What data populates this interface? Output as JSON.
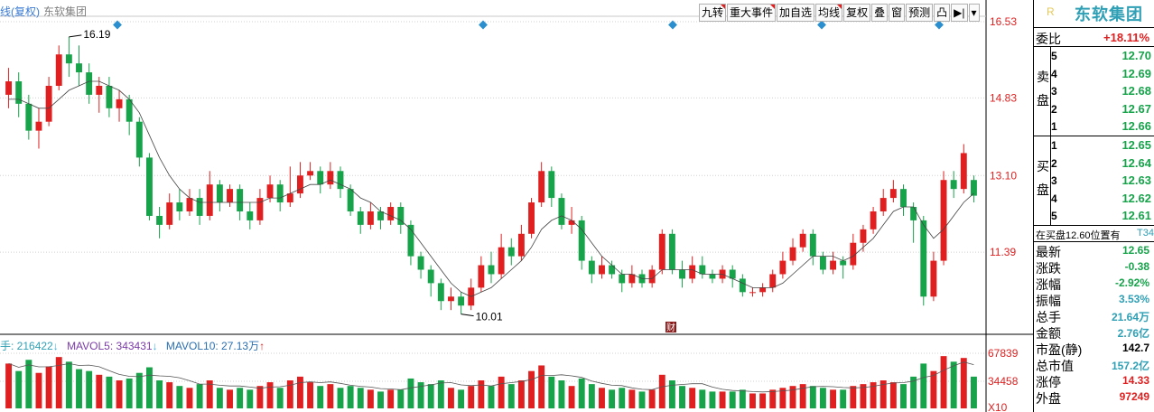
{
  "title": {
    "kline": "线(复权)",
    "stock": "东软集团"
  },
  "toolbar": [
    {
      "label": "九转",
      "flag": true
    },
    {
      "label": "重大事件",
      "flag": true
    },
    {
      "label": "加自选",
      "flag": false
    },
    {
      "label": "均线",
      "flag": true
    },
    {
      "label": "复权",
      "flag": false
    },
    {
      "label": "叠",
      "flag": false
    },
    {
      "label": "窗",
      "flag": false
    },
    {
      "label": "预测",
      "flag": false
    },
    {
      "label": "凸",
      "flag": false
    },
    {
      "label": "▶|",
      "flag": false
    },
    {
      "label": "▾",
      "flag": false
    }
  ],
  "colors": {
    "up": "#e02020",
    "down": "#16a34a",
    "ma": "#444444",
    "event": "#2b8fcf",
    "stock_name": "#2fa0b5"
  },
  "panel": {
    "stock_name": "东软集团",
    "r_mark": "R",
    "weibi_label": "委比",
    "weibi_value": "+18.11%",
    "sell_label": "卖盘",
    "buy_label": "买盘",
    "sell": [
      {
        "level": "5",
        "price": "12.70"
      },
      {
        "level": "4",
        "price": "12.69"
      },
      {
        "level": "3",
        "price": "12.68"
      },
      {
        "level": "2",
        "price": "12.67"
      },
      {
        "level": "1",
        "price": "12.66"
      }
    ],
    "buy": [
      {
        "level": "1",
        "price": "12.65"
      },
      {
        "level": "2",
        "price": "12.64"
      },
      {
        "level": "3",
        "price": "12.63"
      },
      {
        "level": "4",
        "price": "12.62"
      },
      {
        "level": "5",
        "price": "12.61"
      }
    ],
    "notice_left": "在买盘12.60位置有",
    "notice_right": "T34",
    "quotes": [
      {
        "label": "最新",
        "value": "12.65",
        "color": "#16a34a"
      },
      {
        "label": "涨跌",
        "value": "-0.38",
        "color": "#16a34a"
      },
      {
        "label": "涨幅",
        "value": "-2.92%",
        "color": "#16a34a"
      },
      {
        "label": "振幅",
        "value": "3.53%",
        "color": "#2fa0b5"
      },
      {
        "label": "总手",
        "value": "21.64万",
        "color": "#2fa0b5"
      },
      {
        "label": "金额",
        "value": "2.76亿",
        "color": "#2fa0b5"
      },
      {
        "label": "市盈(静)",
        "value": "142.7",
        "color": "#000000"
      },
      {
        "label": "总市值",
        "value": "157.2亿",
        "color": "#2fa0b5"
      },
      {
        "label": "涨停",
        "value": "14.33",
        "color": "#e02020"
      },
      {
        "label": "外盘",
        "value": "97249",
        "color": "#e02020"
      }
    ]
  },
  "volume_legend": {
    "vol_label": "手: 216422",
    "vol_arrow": "↓",
    "mavol5_label": "MAVOL5: 343431",
    "mavol5_arrow": "↓",
    "mavol10_label": "MAVOL10: 27.13万",
    "mavol10_arrow": "↑"
  },
  "chart_data": {
    "type": "candlestick",
    "price_axis": {
      "ticks": [
        "16.53",
        "14.83",
        "13.10",
        "11.39"
      ],
      "range": [
        9.6,
        16.53
      ]
    },
    "volume_axis": {
      "ticks": [
        "67839",
        "34458",
        "X10"
      ]
    },
    "annotations": {
      "high_label": "16.19",
      "low_label": "10.01",
      "event_label": "财"
    },
    "series": [
      {
        "o": 14.9,
        "c": 15.2,
        "h": 15.5,
        "l": 14.6,
        "v": 48
      },
      {
        "o": 15.2,
        "c": 14.7,
        "h": 15.4,
        "l": 14.4,
        "v": 40
      },
      {
        "o": 14.7,
        "c": 14.1,
        "h": 14.9,
        "l": 13.9,
        "v": 52
      },
      {
        "o": 14.1,
        "c": 14.3,
        "h": 14.6,
        "l": 13.7,
        "v": 38
      },
      {
        "o": 14.3,
        "c": 15.1,
        "h": 15.3,
        "l": 14.2,
        "v": 45
      },
      {
        "o": 15.1,
        "c": 15.8,
        "h": 16.0,
        "l": 15.0,
        "v": 55
      },
      {
        "o": 15.8,
        "c": 15.6,
        "h": 16.19,
        "l": 15.3,
        "v": 50
      },
      {
        "o": 15.6,
        "c": 15.4,
        "h": 16.0,
        "l": 15.1,
        "v": 42
      },
      {
        "o": 15.4,
        "c": 14.9,
        "h": 15.6,
        "l": 14.7,
        "v": 40
      },
      {
        "o": 14.9,
        "c": 15.1,
        "h": 15.3,
        "l": 14.5,
        "v": 36
      },
      {
        "o": 15.1,
        "c": 14.6,
        "h": 15.3,
        "l": 14.4,
        "v": 34
      },
      {
        "o": 14.6,
        "c": 14.8,
        "h": 15.0,
        "l": 14.3,
        "v": 30
      },
      {
        "o": 14.8,
        "c": 14.3,
        "h": 14.9,
        "l": 14.0,
        "v": 32
      },
      {
        "o": 14.3,
        "c": 13.5,
        "h": 14.4,
        "l": 13.3,
        "v": 38
      },
      {
        "o": 13.5,
        "c": 12.2,
        "h": 13.6,
        "l": 12.1,
        "v": 44
      },
      {
        "o": 12.2,
        "c": 12.0,
        "h": 12.4,
        "l": 11.7,
        "v": 30
      },
      {
        "o": 12.0,
        "c": 12.5,
        "h": 12.7,
        "l": 11.9,
        "v": 28
      },
      {
        "o": 12.5,
        "c": 12.3,
        "h": 12.8,
        "l": 12.1,
        "v": 24
      },
      {
        "o": 12.3,
        "c": 12.6,
        "h": 12.8,
        "l": 12.2,
        "v": 22
      },
      {
        "o": 12.6,
        "c": 12.2,
        "h": 12.8,
        "l": 12.0,
        "v": 26
      },
      {
        "o": 12.2,
        "c": 12.9,
        "h": 13.2,
        "l": 12.1,
        "v": 30
      },
      {
        "o": 12.9,
        "c": 12.5,
        "h": 13.0,
        "l": 12.3,
        "v": 22
      },
      {
        "o": 12.5,
        "c": 12.8,
        "h": 12.9,
        "l": 12.4,
        "v": 20
      },
      {
        "o": 12.8,
        "c": 12.3,
        "h": 12.9,
        "l": 12.1,
        "v": 22
      },
      {
        "o": 12.3,
        "c": 12.1,
        "h": 12.5,
        "l": 11.9,
        "v": 20
      },
      {
        "o": 12.1,
        "c": 12.6,
        "h": 12.8,
        "l": 12.0,
        "v": 24
      },
      {
        "o": 12.6,
        "c": 12.9,
        "h": 13.1,
        "l": 12.5,
        "v": 28
      },
      {
        "o": 12.9,
        "c": 12.5,
        "h": 13.0,
        "l": 12.3,
        "v": 22
      },
      {
        "o": 12.5,
        "c": 12.7,
        "h": 13.3,
        "l": 12.4,
        "v": 30
      },
      {
        "o": 12.7,
        "c": 13.1,
        "h": 13.4,
        "l": 12.6,
        "v": 34
      },
      {
        "o": 13.1,
        "c": 13.2,
        "h": 13.4,
        "l": 13.0,
        "v": 28
      },
      {
        "o": 13.2,
        "c": 12.9,
        "h": 13.3,
        "l": 12.7,
        "v": 24
      },
      {
        "o": 12.9,
        "c": 13.2,
        "h": 13.4,
        "l": 12.8,
        "v": 26
      },
      {
        "o": 13.2,
        "c": 12.8,
        "h": 13.3,
        "l": 12.6,
        "v": 22
      },
      {
        "o": 12.8,
        "c": 12.3,
        "h": 12.9,
        "l": 12.2,
        "v": 24
      },
      {
        "o": 12.3,
        "c": 12.0,
        "h": 12.4,
        "l": 11.8,
        "v": 22
      },
      {
        "o": 12.0,
        "c": 12.3,
        "h": 12.5,
        "l": 11.9,
        "v": 20
      },
      {
        "o": 12.3,
        "c": 12.1,
        "h": 12.4,
        "l": 11.9,
        "v": 18
      },
      {
        "o": 12.1,
        "c": 12.4,
        "h": 12.5,
        "l": 12.0,
        "v": 20
      },
      {
        "o": 12.4,
        "c": 12.0,
        "h": 12.5,
        "l": 11.8,
        "v": 20
      },
      {
        "o": 12.0,
        "c": 11.3,
        "h": 12.1,
        "l": 11.1,
        "v": 32
      },
      {
        "o": 11.3,
        "c": 11.0,
        "h": 11.4,
        "l": 10.8,
        "v": 28
      },
      {
        "o": 11.0,
        "c": 10.7,
        "h": 11.1,
        "l": 10.4,
        "v": 26
      },
      {
        "o": 10.7,
        "c": 10.3,
        "h": 10.8,
        "l": 10.1,
        "v": 30
      },
      {
        "o": 10.3,
        "c": 10.4,
        "h": 10.6,
        "l": 10.1,
        "v": 22
      },
      {
        "o": 10.4,
        "c": 10.2,
        "h": 10.5,
        "l": 10.01,
        "v": 20
      },
      {
        "o": 10.2,
        "c": 10.6,
        "h": 10.8,
        "l": 10.1,
        "v": 24
      },
      {
        "o": 10.6,
        "c": 11.1,
        "h": 11.3,
        "l": 10.5,
        "v": 30
      },
      {
        "o": 11.1,
        "c": 10.9,
        "h": 11.4,
        "l": 10.7,
        "v": 24
      },
      {
        "o": 10.9,
        "c": 11.5,
        "h": 11.8,
        "l": 10.8,
        "v": 34
      },
      {
        "o": 11.5,
        "c": 11.3,
        "h": 11.7,
        "l": 11.1,
        "v": 26
      },
      {
        "o": 11.3,
        "c": 11.8,
        "h": 12.0,
        "l": 11.2,
        "v": 30
      },
      {
        "o": 11.8,
        "c": 12.5,
        "h": 12.6,
        "l": 11.7,
        "v": 40
      },
      {
        "o": 12.5,
        "c": 13.2,
        "h": 13.4,
        "l": 12.4,
        "v": 46
      },
      {
        "o": 13.2,
        "c": 12.6,
        "h": 13.3,
        "l": 12.4,
        "v": 34
      },
      {
        "o": 12.6,
        "c": 12.0,
        "h": 12.7,
        "l": 11.9,
        "v": 30
      },
      {
        "o": 12.0,
        "c": 12.1,
        "h": 12.4,
        "l": 11.8,
        "v": 24
      },
      {
        "o": 12.1,
        "c": 11.2,
        "h": 12.2,
        "l": 11.0,
        "v": 32
      },
      {
        "o": 11.2,
        "c": 10.9,
        "h": 11.3,
        "l": 10.7,
        "v": 26
      },
      {
        "o": 10.9,
        "c": 11.1,
        "h": 11.3,
        "l": 10.8,
        "v": 22
      },
      {
        "o": 11.1,
        "c": 10.9,
        "h": 11.2,
        "l": 10.8,
        "v": 20
      },
      {
        "o": 10.9,
        "c": 10.7,
        "h": 11.0,
        "l": 10.5,
        "v": 22
      },
      {
        "o": 10.7,
        "c": 10.9,
        "h": 11.1,
        "l": 10.6,
        "v": 20
      },
      {
        "o": 10.9,
        "c": 10.7,
        "h": 11.0,
        "l": 10.6,
        "v": 18
      },
      {
        "o": 10.7,
        "c": 11.0,
        "h": 11.1,
        "l": 10.6,
        "v": 20
      },
      {
        "o": 11.0,
        "c": 11.8,
        "h": 11.9,
        "l": 10.9,
        "v": 36
      },
      {
        "o": 11.8,
        "c": 11.0,
        "h": 11.9,
        "l": 10.9,
        "v": 30
      },
      {
        "o": 11.0,
        "c": 10.8,
        "h": 11.2,
        "l": 10.6,
        "v": 24
      },
      {
        "o": 10.8,
        "c": 11.1,
        "h": 11.3,
        "l": 10.7,
        "v": 22
      },
      {
        "o": 11.1,
        "c": 10.9,
        "h": 11.3,
        "l": 10.8,
        "v": 20
      },
      {
        "o": 10.9,
        "c": 10.8,
        "h": 11.0,
        "l": 10.7,
        "v": 18
      },
      {
        "o": 10.8,
        "c": 11.0,
        "h": 11.1,
        "l": 10.7,
        "v": 18
      },
      {
        "o": 11.0,
        "c": 10.8,
        "h": 11.1,
        "l": 10.6,
        "v": 18
      },
      {
        "o": 10.8,
        "c": 10.5,
        "h": 10.9,
        "l": 10.4,
        "v": 20
      },
      {
        "o": 10.5,
        "c": 10.5,
        "h": 10.6,
        "l": 10.4,
        "v": 16
      },
      {
        "o": 10.5,
        "c": 10.6,
        "h": 10.7,
        "l": 10.4,
        "v": 16
      },
      {
        "o": 10.6,
        "c": 10.9,
        "h": 11.0,
        "l": 10.5,
        "v": 20
      },
      {
        "o": 10.9,
        "c": 11.2,
        "h": 11.4,
        "l": 10.8,
        "v": 22
      },
      {
        "o": 11.2,
        "c": 11.5,
        "h": 11.7,
        "l": 11.1,
        "v": 24
      },
      {
        "o": 11.5,
        "c": 11.8,
        "h": 11.9,
        "l": 11.4,
        "v": 26
      },
      {
        "o": 11.8,
        "c": 11.3,
        "h": 11.9,
        "l": 11.1,
        "v": 24
      },
      {
        "o": 11.3,
        "c": 11.0,
        "h": 11.4,
        "l": 10.9,
        "v": 22
      },
      {
        "o": 11.0,
        "c": 11.2,
        "h": 11.4,
        "l": 10.9,
        "v": 20
      },
      {
        "o": 11.2,
        "c": 11.1,
        "h": 11.3,
        "l": 10.8,
        "v": 20
      },
      {
        "o": 11.1,
        "c": 11.6,
        "h": 11.8,
        "l": 11.0,
        "v": 24
      },
      {
        "o": 11.6,
        "c": 11.9,
        "h": 12.0,
        "l": 11.4,
        "v": 26
      },
      {
        "o": 11.9,
        "c": 12.3,
        "h": 12.4,
        "l": 11.8,
        "v": 28
      },
      {
        "o": 12.3,
        "c": 12.6,
        "h": 12.8,
        "l": 12.2,
        "v": 30
      },
      {
        "o": 12.6,
        "c": 12.8,
        "h": 13.0,
        "l": 12.5,
        "v": 28
      },
      {
        "o": 12.8,
        "c": 12.4,
        "h": 12.9,
        "l": 12.2,
        "v": 26
      },
      {
        "o": 12.4,
        "c": 12.1,
        "h": 12.5,
        "l": 11.6,
        "v": 34
      },
      {
        "o": 12.1,
        "c": 10.4,
        "h": 12.2,
        "l": 10.2,
        "v": 48
      },
      {
        "o": 10.4,
        "c": 11.2,
        "h": 11.4,
        "l": 10.3,
        "v": 40
      },
      {
        "o": 11.2,
        "c": 13.0,
        "h": 13.2,
        "l": 11.1,
        "v": 56
      },
      {
        "o": 13.0,
        "c": 12.8,
        "h": 13.2,
        "l": 12.6,
        "v": 50
      },
      {
        "o": 12.8,
        "c": 13.6,
        "h": 13.8,
        "l": 12.7,
        "v": 54
      },
      {
        "o": 13.0,
        "c": 12.65,
        "h": 13.1,
        "l": 12.5,
        "v": 34
      }
    ],
    "ma_line": [
      14.8,
      14.8,
      14.7,
      14.6,
      14.6,
      14.8,
      15.0,
      15.1,
      15.2,
      15.2,
      15.1,
      15.0,
      14.8,
      14.5,
      14.0,
      13.5,
      13.1,
      12.8,
      12.6,
      12.5,
      12.5,
      12.5,
      12.5,
      12.5,
      12.5,
      12.5,
      12.6,
      12.6,
      12.7,
      12.8,
      12.9,
      12.9,
      13.0,
      12.9,
      12.8,
      12.6,
      12.5,
      12.3,
      12.2,
      12.1,
      11.9,
      11.6,
      11.3,
      11.0,
      10.7,
      10.5,
      10.4,
      10.5,
      10.6,
      10.8,
      11.0,
      11.2,
      11.5,
      11.9,
      12.1,
      12.2,
      12.1,
      11.9,
      11.6,
      11.3,
      11.1,
      10.9,
      10.9,
      10.8,
      10.8,
      11.0,
      11.0,
      11.0,
      11.0,
      10.9,
      10.9,
      10.9,
      10.8,
      10.7,
      10.6,
      10.6,
      10.6,
      10.7,
      10.9,
      11.1,
      11.3,
      11.3,
      11.3,
      11.2,
      11.3,
      11.5,
      11.7,
      12.0,
      12.3,
      12.4,
      12.4,
      12.0,
      11.7,
      11.9,
      12.2,
      12.5,
      12.7
    ]
  }
}
